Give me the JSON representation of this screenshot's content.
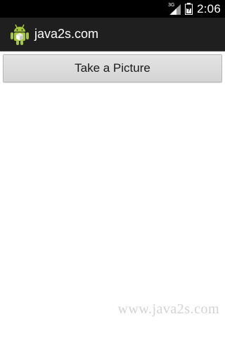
{
  "status_bar": {
    "network_type": "3G",
    "time": "2:06",
    "icons": [
      "signal-icon",
      "battery-icon"
    ]
  },
  "action_bar": {
    "title": "java2s.com",
    "icon": "android-robot-icon"
  },
  "main": {
    "take_picture_label": "Take a Picture"
  },
  "watermark": "www.java2s.com",
  "colors": {
    "status_bar_bg": "#000000",
    "action_bar_bg": "#1f1f1f",
    "button_bg": "#d9d9d9",
    "android_green": "#a4c639"
  }
}
